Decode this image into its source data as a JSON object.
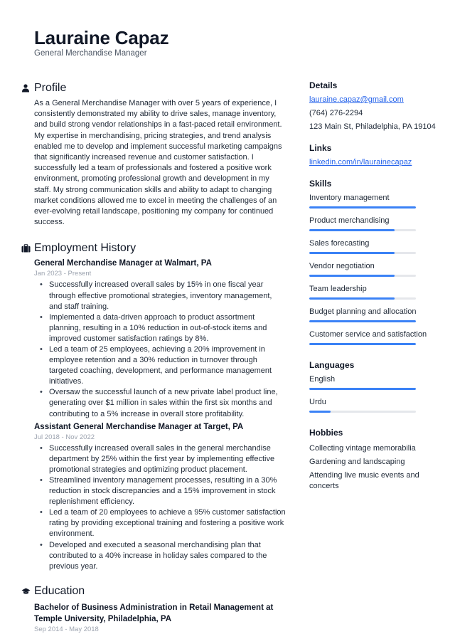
{
  "header": {
    "name": "Lauraine Capaz",
    "job_title": "General Merchandise Manager"
  },
  "profile": {
    "icon": "person-icon",
    "title": "Profile",
    "text": "As a General Merchandise Manager with over 5 years of experience, I consistently demonstrated my ability to drive sales, manage inventory, and build strong vendor relationships in a fast-paced retail environment. My expertise in merchandising, pricing strategies, and trend analysis enabled me to develop and implement successful marketing campaigns that significantly increased revenue and customer satisfaction. I successfully led a team of professionals and fostered a positive work environment, promoting professional growth and development in my staff. My strong communication skills and ability to adapt to changing market conditions allowed me to excel in meeting the challenges of an ever-evolving retail landscape, positioning my company for continued success."
  },
  "employment": {
    "icon": "briefcase-icon",
    "title": "Employment History",
    "jobs": [
      {
        "heading": "General Merchandise Manager at Walmart, PA",
        "dates": "Jan 2023 - Present",
        "bullets": [
          "Successfully increased overall sales by 15% in one fiscal year through effective promotional strategies, inventory management, and staff training.",
          "Implemented a data-driven approach to product assortment planning, resulting in a 10% reduction in out-of-stock items and improved customer satisfaction ratings by 8%.",
          "Led a team of 25 employees, achieving a 20% improvement in employee retention and a 30% reduction in turnover through targeted coaching, development, and performance management initiatives.",
          "Oversaw the successful launch of a new private label product line, generating over $1 million in sales within the first six months and contributing to a 5% increase in overall store profitability."
        ]
      },
      {
        "heading": "Assistant General Merchandise Manager at Target, PA",
        "dates": "Jul 2018 - Nov 2022",
        "bullets": [
          "Successfully increased overall sales in the general merchandise department by 25% within the first year by implementing effective promotional strategies and optimizing product placement.",
          "Streamlined inventory management processes, resulting in a 30% reduction in stock discrepancies and a 15% improvement in stock replenishment efficiency.",
          "Led a team of 20 employees to achieve a 95% customer satisfaction rating by providing exceptional training and fostering a positive work environment.",
          "Developed and executed a seasonal merchandising plan that contributed to a 40% increase in holiday sales compared to the previous year."
        ]
      }
    ]
  },
  "education": {
    "icon": "graduation-cap-icon",
    "title": "Education",
    "entries": [
      {
        "heading": "Bachelor of Business Administration in Retail Management at Temple University, Philadelphia, PA",
        "dates": "Sep 2014 - May 2018"
      }
    ]
  },
  "details": {
    "title": "Details",
    "email": "lauraine.capaz@gmail.com",
    "phone": "(764) 276-2294",
    "address": "123 Main St, Philadelphia, PA 19104"
  },
  "links": {
    "title": "Links",
    "items": [
      "linkedin.com/in/laurainecapaz"
    ]
  },
  "skills": {
    "title": "Skills",
    "items": [
      {
        "label": "Inventory management",
        "level": 1.0
      },
      {
        "label": "Product merchandising",
        "level": 0.8
      },
      {
        "label": "Sales forecasting",
        "level": 0.8
      },
      {
        "label": "Vendor negotiation",
        "level": 0.8
      },
      {
        "label": "Team leadership",
        "level": 0.8
      },
      {
        "label": "Budget planning and allocation",
        "level": 1.0
      },
      {
        "label": "Customer service and satisfaction",
        "level": 1.0
      }
    ]
  },
  "languages": {
    "title": "Languages",
    "items": [
      {
        "label": "English",
        "level": 1.0
      },
      {
        "label": "Urdu",
        "level": 0.2
      }
    ]
  },
  "hobbies": {
    "title": "Hobbies",
    "items": [
      "Collecting vintage memorabilia",
      "Gardening and landscaping",
      "Attending live music events and concerts"
    ]
  },
  "colors": {
    "accent": "#3b82f6",
    "link": "#2563eb",
    "bar_track": "#e5e7eb"
  }
}
